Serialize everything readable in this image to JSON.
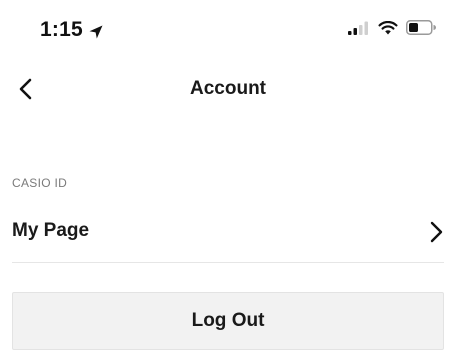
{
  "status_bar": {
    "time": "1:15",
    "location_icon": "location-arrow-icon",
    "signal_icon": "cellular-signal-icon",
    "wifi_icon": "wifi-icon",
    "battery_icon": "battery-icon"
  },
  "nav": {
    "back_icon": "chevron-left-icon",
    "title": "Account"
  },
  "section": {
    "header": "CASIO ID"
  },
  "rows": [
    {
      "label": "My Page",
      "icon": "chevron-right-icon"
    }
  ],
  "actions": {
    "logout_label": "Log Out"
  }
}
